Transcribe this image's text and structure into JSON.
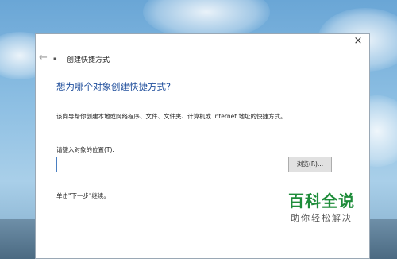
{
  "window": {
    "title": "创建快捷方式",
    "close_glyph": "×",
    "back_glyph": "←",
    "icon": "shortcut-wizard-icon"
  },
  "main": {
    "heading": "想为哪个对象创建快捷方式?",
    "description": "该向导帮你创建本地或网络程序、文件、文件夹、计算机或 Internet 地址的快捷方式。",
    "location_label": "请键入对象的位置(T):",
    "location_value": "",
    "browse_label": "浏览(R)...",
    "hint": "单击\"下一步\"继续。"
  },
  "watermark": {
    "brand": "百科全说",
    "tagline": "助你轻松解决"
  }
}
